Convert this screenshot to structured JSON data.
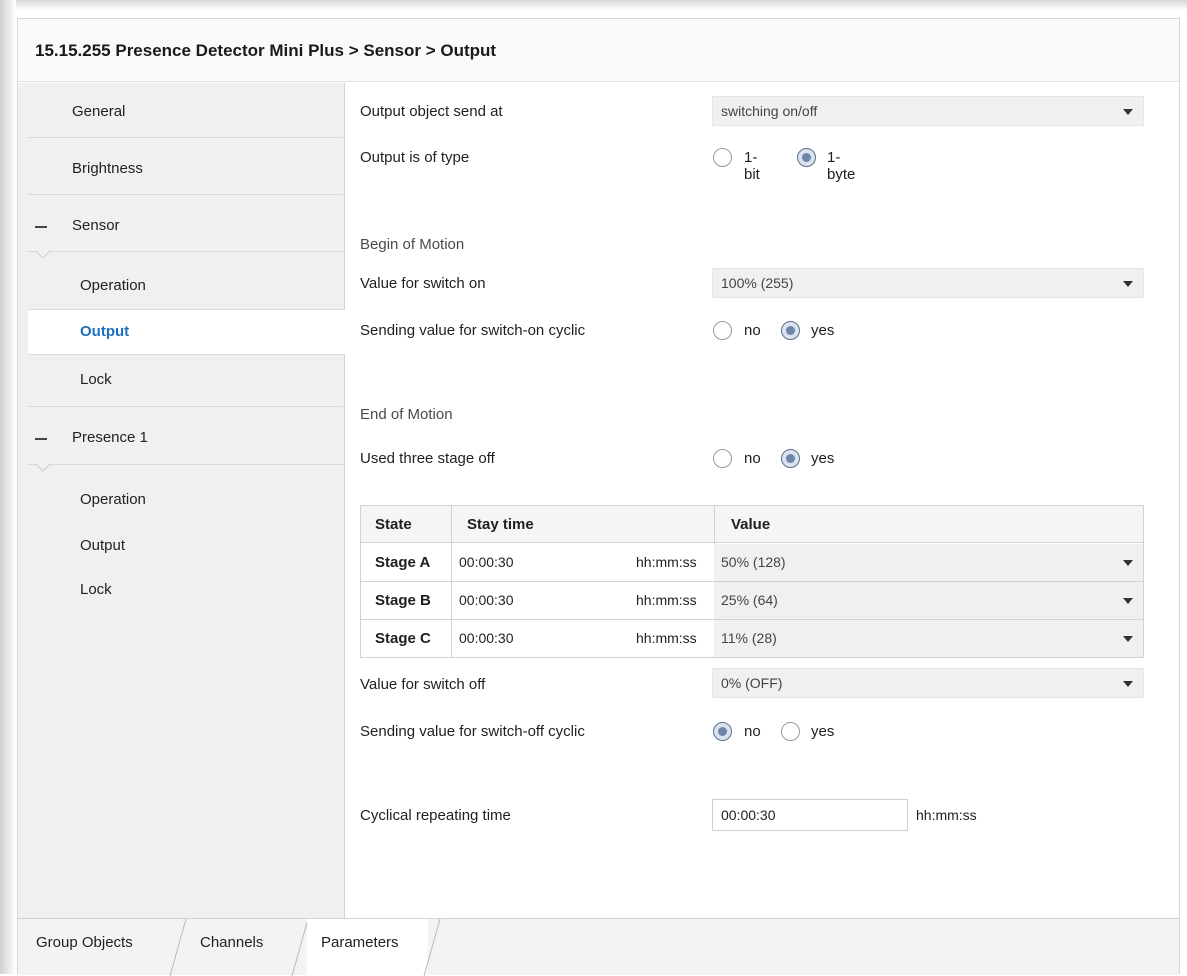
{
  "window": {
    "title": "15.15.255 Presence Detector Mini Plus > Sensor > Output"
  },
  "sidebar": {
    "items": [
      {
        "label": "General",
        "level": 0
      },
      {
        "label": "Brightness",
        "level": 0
      },
      {
        "label": "Sensor",
        "level": 0,
        "expanded": true
      },
      {
        "label": "Operation",
        "level": 1
      },
      {
        "label": "Output",
        "level": 1,
        "selected": true
      },
      {
        "label": "Lock",
        "level": 1
      },
      {
        "label": "Presence 1",
        "level": 0,
        "expanded": true
      },
      {
        "label": "Operation",
        "level": 1
      },
      {
        "label": "Output",
        "level": 1
      },
      {
        "label": "Lock",
        "level": 1
      }
    ]
  },
  "params": {
    "output_send_at": {
      "label": "Output object send at",
      "value": "switching on/off"
    },
    "output_type": {
      "label": "Output is of type",
      "options": [
        "1-bit",
        "1-byte"
      ],
      "selected": "1-byte"
    },
    "begin_section": "Begin of Motion",
    "switch_on_value": {
      "label": "Value for switch on",
      "value": "100% (255)"
    },
    "switch_on_cyclic": {
      "label": "Sending value for switch-on cyclic",
      "options": [
        "no",
        "yes"
      ],
      "selected": "yes"
    },
    "end_section": "End of Motion",
    "three_stage": {
      "label": "Used three stage off",
      "options": [
        "no",
        "yes"
      ],
      "selected": "yes"
    },
    "stage_table": {
      "headers": [
        "State",
        "Stay time",
        "Value"
      ],
      "rows": [
        {
          "state": "Stage A",
          "time": "00:00:30",
          "unit": "hh:mm:ss",
          "value": "50% (128)"
        },
        {
          "state": "Stage B",
          "time": "00:00:30",
          "unit": "hh:mm:ss",
          "value": "25% (64)"
        },
        {
          "state": "Stage C",
          "time": "00:00:30",
          "unit": "hh:mm:ss",
          "value": "11% (28)"
        }
      ]
    },
    "switch_off_value": {
      "label": "Value for switch off",
      "value": "0% (OFF)"
    },
    "switch_off_cyclic": {
      "label": "Sending value for switch-off cyclic",
      "options": [
        "no",
        "yes"
      ],
      "selected": "no"
    },
    "cyclic_time": {
      "label": "Cyclical repeating time",
      "value": "00:00:30",
      "unit": "hh:mm:ss"
    }
  },
  "tabs": {
    "items": [
      "Group Objects",
      "Channels",
      "Parameters"
    ],
    "active": "Parameters"
  },
  "colors": {
    "selected_nav_text": "#1d6fb8",
    "sidebar_bg": "#f0f0f0",
    "dropdown_bg": "#f0f0f0",
    "radio_checked": "#6d86a8"
  }
}
